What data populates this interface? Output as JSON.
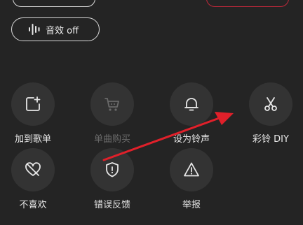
{
  "sound_effect": {
    "label": "音效 off",
    "icon": "sound-wave-icon"
  },
  "actions": [
    {
      "label": "加到歌单",
      "icon": "add-playlist-icon",
      "enabled": true
    },
    {
      "label": "单曲购买",
      "icon": "shopping-cart-icon",
      "enabled": false
    },
    {
      "label": "设为铃声",
      "icon": "bell-icon",
      "enabled": true
    },
    {
      "label": "彩铃 DIY",
      "icon": "scissors-icon",
      "enabled": true
    },
    {
      "label": "不喜欢",
      "icon": "broken-heart-icon",
      "enabled": true
    },
    {
      "label": "错误反馈",
      "icon": "shield-alert-icon",
      "enabled": true
    },
    {
      "label": "举报",
      "icon": "warning-icon",
      "enabled": true
    }
  ],
  "colors": {
    "background": "#242424",
    "circle": "#333333",
    "accent_red": "#e0202a",
    "disabled_text": "#6a6a6a"
  }
}
